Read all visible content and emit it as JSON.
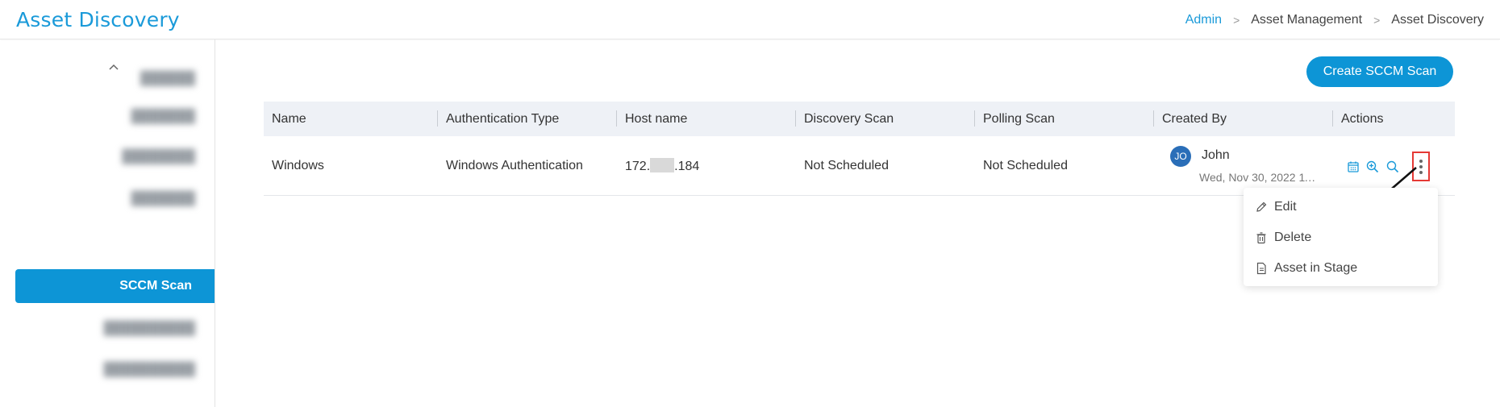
{
  "header": {
    "title": "Asset Discovery",
    "breadcrumb": [
      "Admin",
      "Asset Management",
      "Asset Discovery"
    ]
  },
  "sidebar": {
    "collapse_icon": "chevron-up-icon",
    "active_label": "SCCM Scan"
  },
  "toolbar": {
    "create_label": "Create SCCM Scan"
  },
  "table": {
    "columns": [
      "Name",
      "Authentication Type",
      "Host name",
      "Discovery Scan",
      "Polling Scan",
      "Created By",
      "Actions"
    ],
    "row": {
      "name": "Windows",
      "auth_type": "Windows Authentication",
      "host_prefix": "172.",
      "host_suffix": ".184",
      "discovery": "Not Scheduled",
      "polling": "Not Scheduled",
      "creator_initials": "JO",
      "creator_name": "John",
      "created_date": "Wed, Nov 30, 2022 11:2..."
    }
  },
  "actions_menu": {
    "items": [
      {
        "label": "Edit",
        "icon": "pencil-icon"
      },
      {
        "label": "Delete",
        "icon": "trash-icon"
      },
      {
        "label": "Asset in Stage",
        "icon": "document-icon"
      }
    ]
  },
  "colors": {
    "accent": "#0d95d6",
    "title": "#1a9ad9",
    "highlight": "#e53935"
  }
}
